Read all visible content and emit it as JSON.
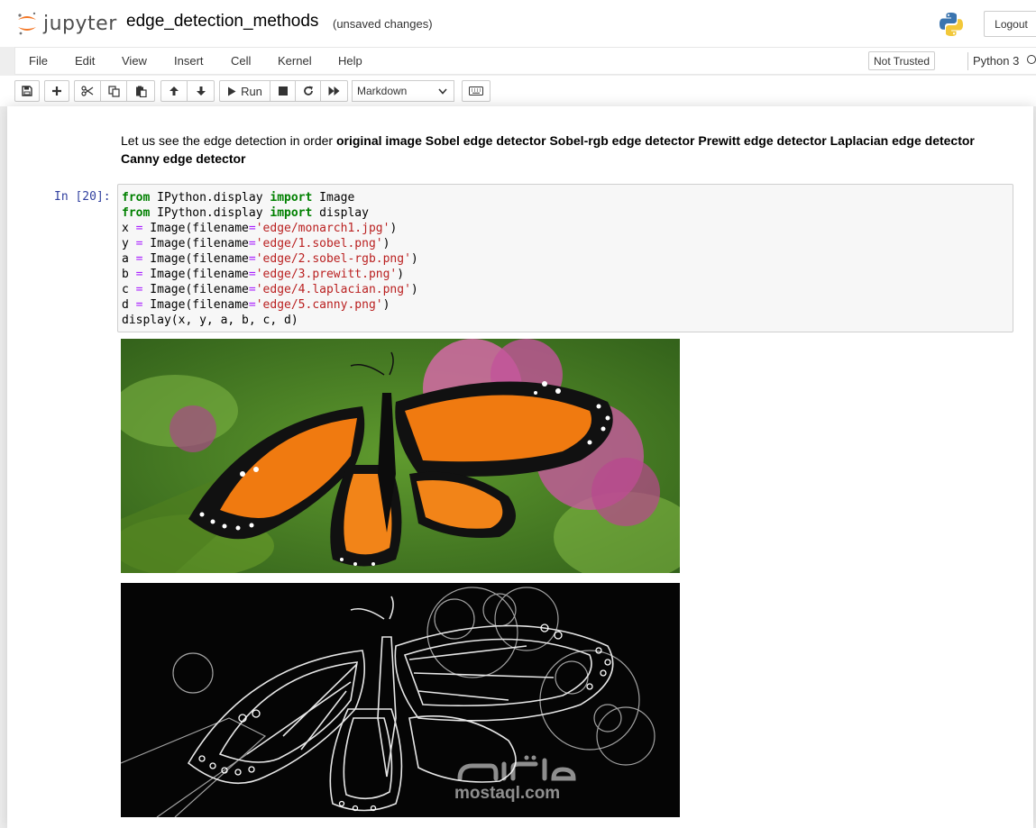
{
  "header": {
    "logo_text": "jupyter",
    "notebook_title": "edge_detection_methods",
    "save_status": "(unsaved changes)",
    "logout_label": "Logout"
  },
  "menubar": {
    "items": [
      "File",
      "Edit",
      "View",
      "Insert",
      "Cell",
      "Kernel",
      "Help"
    ],
    "trust_label": "Not Trusted",
    "kernel_name": "Python 3"
  },
  "toolbar": {
    "run_label": "Run",
    "cell_type": "Markdown",
    "icons": [
      "save-icon",
      "plus-icon",
      "cut-icon",
      "copy-icon",
      "paste-icon",
      "arrow-up-icon",
      "arrow-down-icon",
      "play-icon",
      "stop-icon",
      "restart-icon",
      "fast-forward-icon",
      "keyboard-icon"
    ]
  },
  "markdown_cell": {
    "intro": "Let us see the edge detection in order ",
    "bold_text": "original image Sobel edge detector Sobel-rgb edge detector Prewitt edge detector Laplacian edge detector Canny edge detector"
  },
  "code_cell": {
    "prompt": "In [20]:",
    "lines": [
      [
        {
          "t": "from",
          "c": "kw"
        },
        {
          "t": " IPython.display ",
          "c": ""
        },
        {
          "t": "import",
          "c": "kw"
        },
        {
          "t": " Image",
          "c": ""
        }
      ],
      [
        {
          "t": "from",
          "c": "kw"
        },
        {
          "t": " IPython.display ",
          "c": ""
        },
        {
          "t": "import",
          "c": "kw"
        },
        {
          "t": " display",
          "c": ""
        }
      ],
      [
        {
          "t": "x ",
          "c": ""
        },
        {
          "t": "=",
          "c": "op"
        },
        {
          "t": " Image(filename",
          "c": ""
        },
        {
          "t": "=",
          "c": "op"
        },
        {
          "t": "'edge/monarch1.jpg'",
          "c": "str"
        },
        {
          "t": ")",
          "c": ""
        }
      ],
      [
        {
          "t": "y ",
          "c": ""
        },
        {
          "t": "=",
          "c": "op"
        },
        {
          "t": " Image(filename",
          "c": ""
        },
        {
          "t": "=",
          "c": "op"
        },
        {
          "t": "'edge/1.sobel.png'",
          "c": "str"
        },
        {
          "t": ")",
          "c": ""
        }
      ],
      [
        {
          "t": "a ",
          "c": ""
        },
        {
          "t": "=",
          "c": "op"
        },
        {
          "t": " Image(filename",
          "c": ""
        },
        {
          "t": "=",
          "c": "op"
        },
        {
          "t": "'edge/2.sobel-rgb.png'",
          "c": "str"
        },
        {
          "t": ")",
          "c": ""
        }
      ],
      [
        {
          "t": "b ",
          "c": ""
        },
        {
          "t": "=",
          "c": "op"
        },
        {
          "t": " Image(filename",
          "c": ""
        },
        {
          "t": "=",
          "c": "op"
        },
        {
          "t": "'edge/3.prewitt.png'",
          "c": "str"
        },
        {
          "t": ")",
          "c": ""
        }
      ],
      [
        {
          "t": "c ",
          "c": ""
        },
        {
          "t": "=",
          "c": "op"
        },
        {
          "t": " Image(filename",
          "c": ""
        },
        {
          "t": "=",
          "c": "op"
        },
        {
          "t": "'edge/4.laplacian.png'",
          "c": "str"
        },
        {
          "t": ")",
          "c": ""
        }
      ],
      [
        {
          "t": "d ",
          "c": ""
        },
        {
          "t": "=",
          "c": "op"
        },
        {
          "t": " Image(filename",
          "c": ""
        },
        {
          "t": "=",
          "c": "op"
        },
        {
          "t": "'edge/5.canny.png'",
          "c": "str"
        },
        {
          "t": ")",
          "c": ""
        }
      ],
      [
        {
          "t": "display(x, y, a, b, c, d)",
          "c": ""
        }
      ]
    ]
  },
  "outputs": {
    "watermark_text": "mostaql.com"
  },
  "colors": {
    "prompt_in": "#303f9f",
    "keyword": "#008000",
    "string": "#ba2121",
    "operator": "#aa22ff",
    "jupyter_orange": "#f37726"
  }
}
